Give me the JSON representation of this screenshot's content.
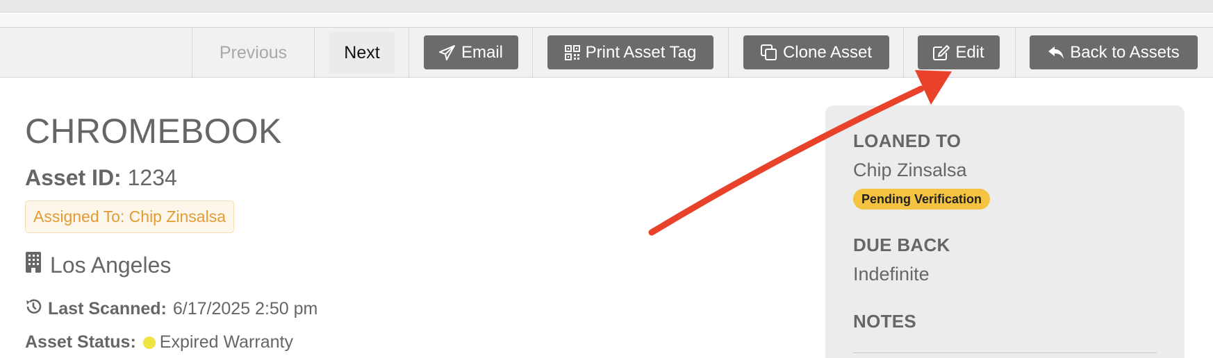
{
  "toolbar": {
    "previous_label": "Previous",
    "next_label": "Next",
    "email_label": "Email",
    "print_tag_label": "Print Asset Tag",
    "clone_label": "Clone Asset",
    "edit_label": "Edit",
    "back_label": "Back to Assets"
  },
  "asset": {
    "title": "CHROMEBOOK",
    "id_label": "Asset ID:",
    "id_value": "1234",
    "assigned_text": "Assigned To: Chip Zinsalsa",
    "location": "Los Angeles",
    "last_scanned_label": "Last Scanned:",
    "last_scanned_value": "6/17/2025 2:50 pm",
    "status_label": "Asset Status:",
    "status_value": "Expired Warranty",
    "status_color": "#f0e442"
  },
  "loan_panel": {
    "loaned_to_heading": "LOANED TO",
    "loaned_to_value": "Chip Zinsalsa",
    "badge_text": "Pending Verification",
    "badge_color": "#f5c342",
    "due_back_heading": "DUE BACK",
    "due_back_value": "Indefinite",
    "notes_heading": "NOTES"
  },
  "annotation": {
    "arrow_color": "#e8432a"
  },
  "icons": {
    "email": "paper-plane-icon",
    "print_tag": "qr-code-icon",
    "clone": "copy-icon",
    "edit": "edit-icon",
    "back": "reply-icon",
    "location": "building-icon",
    "last_scanned": "history-icon"
  }
}
